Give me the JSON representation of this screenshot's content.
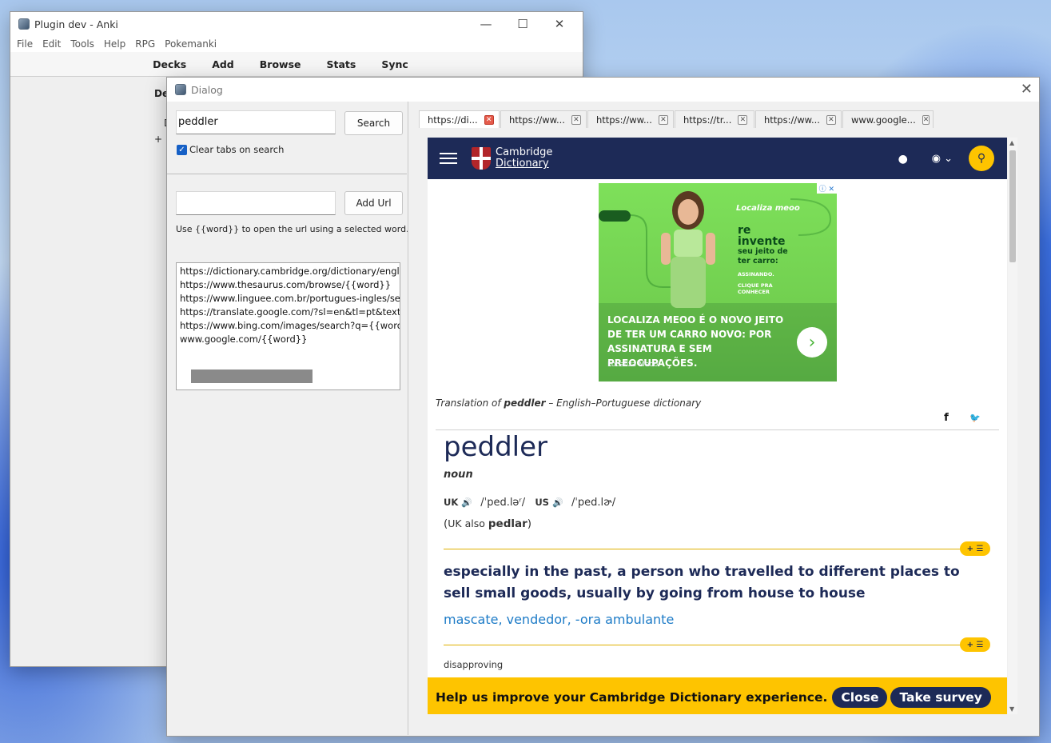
{
  "anki": {
    "title": "Plugin dev - Anki",
    "controls": {
      "minimize": "—",
      "maximize": "☐",
      "close": "✕"
    },
    "menu": [
      "File",
      "Edit",
      "Tools",
      "Help",
      "RPG",
      "Pokemanki"
    ],
    "toolbar": [
      "Decks",
      "Add",
      "Browse",
      "Stats",
      "Sync"
    ],
    "body_fragments": {
      "heading": "De",
      "row1": "D",
      "row2": "+ M"
    }
  },
  "dialog": {
    "title": "Dialog",
    "close": "✕",
    "search": {
      "value": "peddler",
      "button": "Search"
    },
    "clear_tabs": {
      "checked": true,
      "label": "Clear tabs on search",
      "check_glyph": "✓"
    },
    "add_url": {
      "value": "",
      "button": "Add Url"
    },
    "hint": "Use {{word}} to open the url using a selected word.",
    "urls": [
      "https://dictionary.cambridge.org/dictionary/english",
      "https://www.thesaurus.com/browse/{{word}}",
      "https://www.linguee.com.br/portugues-ingles/searc",
      "https://translate.google.com/?sl=en&tl=pt&text={{",
      "https://www.bing.com/images/search?q={{word}}",
      "www.google.com/{{word}}"
    ],
    "tabs": [
      {
        "label": "https://di...",
        "active": true,
        "close": "✕"
      },
      {
        "label": "https://ww...",
        "active": false,
        "close": "✕"
      },
      {
        "label": "https://ww...",
        "active": false,
        "close": "✕"
      },
      {
        "label": "https://tr...",
        "active": false,
        "close": "✕"
      },
      {
        "label": "https://ww...",
        "active": false,
        "close": "✕"
      },
      {
        "label": "www.google...",
        "active": false,
        "close": "✕"
      }
    ]
  },
  "web": {
    "logo_line1": "Cambridge",
    "logo_line2": "Dictionary",
    "icons": {
      "user": "user-icon",
      "globe": "globe-icon",
      "search": "search-icon"
    },
    "icon_glyphs": {
      "user": "●",
      "globe": "◉ ⌄",
      "search": "⚲",
      "facebook": "f",
      "twitter": "🐦",
      "arrow": "›",
      "speaker": "🔊",
      "plus_list": "+ ☰"
    },
    "ad": {
      "brand": "Localiza meoo",
      "re": "re",
      "invente": "invente",
      "tagline": "seu jeito de ter carro:",
      "assinando": "ASSINANDO.",
      "clique": "CLIQUE PRA CONHECER",
      "headline": "LOCALIZA MEOO É O NOVO JEITO DE TER UM CARRO NOVO: POR ASSINATURA E SEM PREOCUPAÇÕES.",
      "sponsor": "Localiza Meoo",
      "adchoices": "ⓘ ✕"
    },
    "translation_prefix": "Translation of ",
    "translation_word": "peddler",
    "translation_suffix": " – English–Portuguese dictionary",
    "headword": "peddler",
    "pos": "noun",
    "uk_label": "UK",
    "uk_ipa": "/ˈped.ləʳ/",
    "us_label": "US",
    "us_ipa": "/ˈped.lɚ/",
    "also_open": "(",
    "also_prefix": "UK also ",
    "also_word": "pedlar",
    "also_close": ")",
    "definition": "especially in the past, a person who travelled to different places to sell small goods, usually by going from house to house",
    "translation": "mascate, vendedor, -ora ambulante",
    "label_disapproving": "disapproving",
    "survey": {
      "text": "Help us improve your Cambridge Dictionary experience.",
      "close": "Close",
      "take": "Take survey"
    }
  },
  "colors": {
    "brand_navy": "#1d2a57",
    "brand_yellow": "#fec400",
    "link_blue": "#1d7bc7",
    "checkbox_blue": "#1660c6"
  }
}
